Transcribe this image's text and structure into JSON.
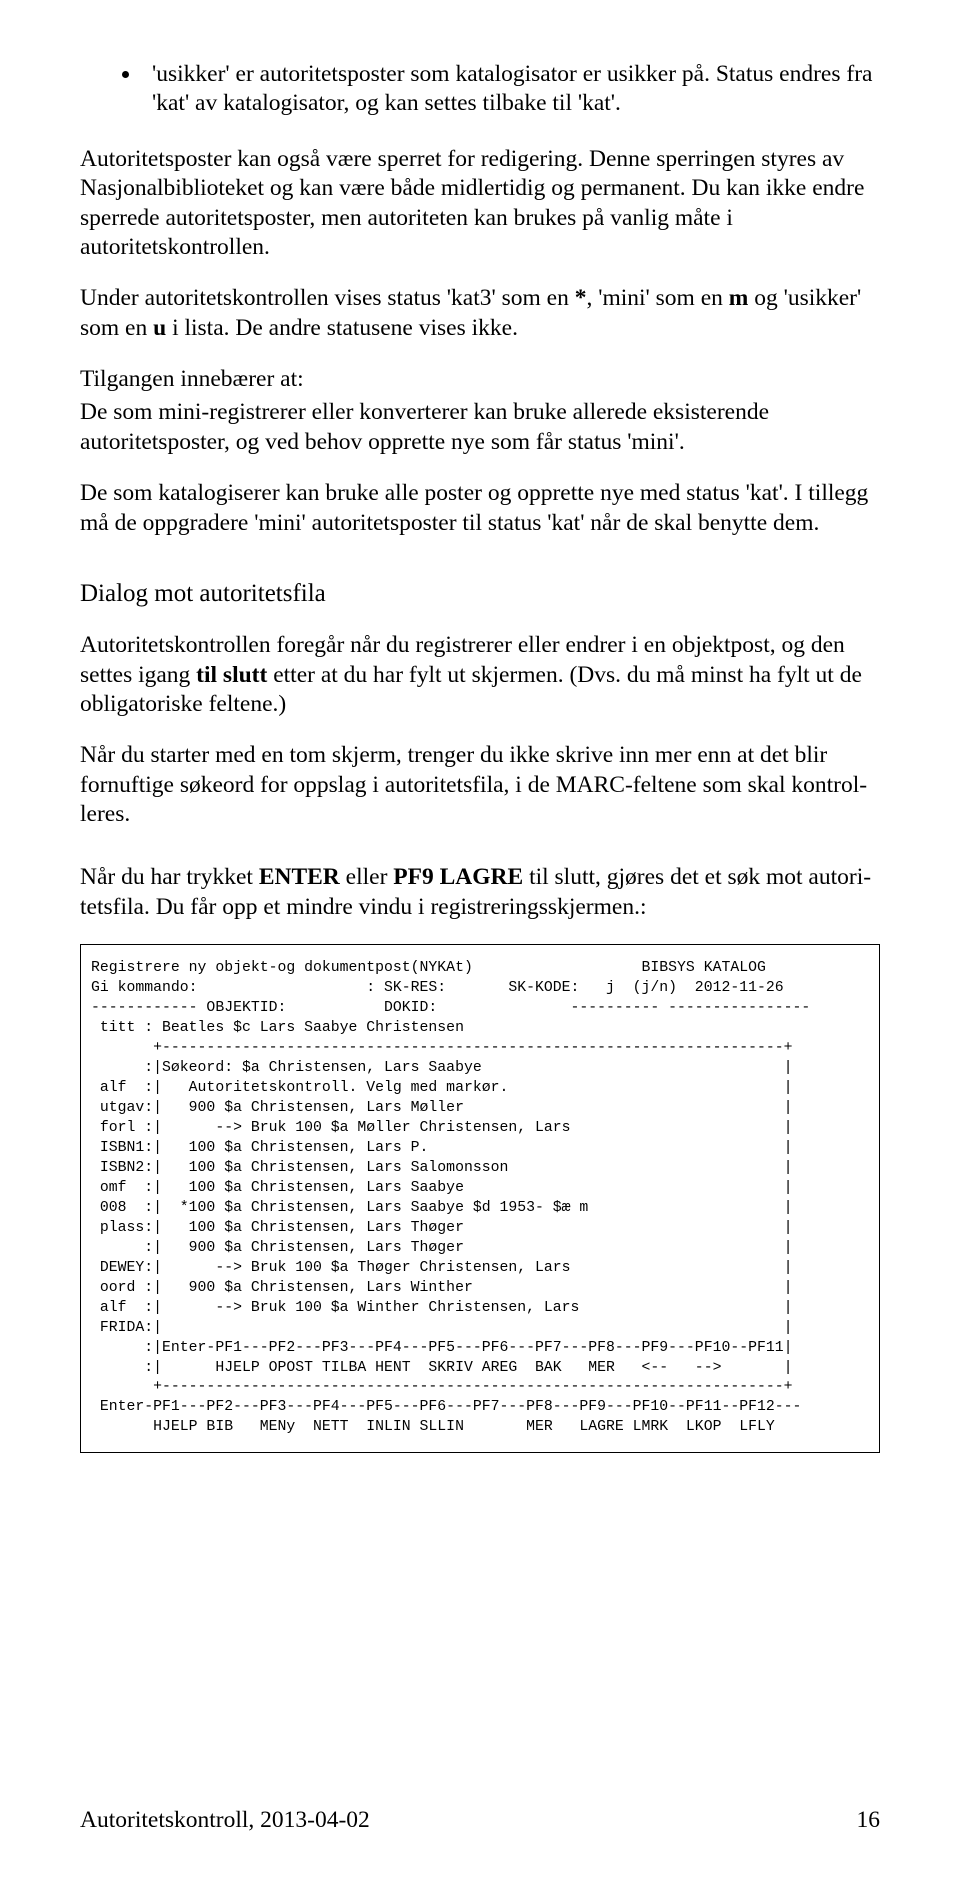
{
  "bullet": "'usikker' er autoritetsposter som katalogisator er usikker på. Status endres fra 'kat' av katalogisator, og kan settes tilbake til 'kat'.",
  "p1": "Autoritetsposter kan også være sperret for redigering. Denne sperringen styres av Nasjonalbiblioteket og kan være både midlertidig og permanent. Du kan ikke endre sperrede autoritetsposter, men autoriteten kan brukes på vanlig måte i autoritetskontrollen.",
  "p2_a": "Under autoritetskontrollen vises status 'kat3' som en ",
  "p2_b": ", 'mini' som en ",
  "p2_c": " og 'usikker' som en ",
  "p2_d": " i lista. De andre statusene vises ikke.",
  "star": "*",
  "m": "m",
  "u": "u",
  "p3": "Tilgangen innebærer at:",
  "p4": "De som mini-registrerer eller konverterer kan bruke allerede eksisterende autoritetsposter, og ved behov opprette nye som får status 'mini'.",
  "p5": "De som katalogiserer kan bruke alle poster og opprette nye med status 'kat'. I tillegg må de oppgradere 'mini' autoritetsposter til status 'kat' når de skal benytte dem.",
  "heading": "Dialog mot autoritetsfila",
  "p6_a": "Autoritetskontrollen foregår når du registrerer eller endrer i en objektpost, og den settes igang ",
  "p6_bold": "til slutt",
  "p6_b": " etter at du har fylt ut skjermen. (Dvs. du må minst ha fylt ut de obligatoriske feltene.)",
  "p7": "Når du starter med en tom skjerm, trenger du ikke skrive inn mer enn at det blir fornuftige søkeord for oppslag i autoritetsfila, i de MARC-feltene som skal kontrol­leres.",
  "p8_a": "Når du har trykket ",
  "p8_b1": "ENTER",
  "p8_c": " eller ",
  "p8_b2": "PF9 LAGRE",
  "p8_d": " til slutt, gjøres det et søk mot autori­tetsfila. Du får opp et mindre vindu i registreringsskjermen.:",
  "screen": "Registrere ny objekt-og dokumentpost(NYKAt)                   BIBSYS KATALOG\nGi kommando:                   : SK-RES:       SK-KODE:   j  (j/n)  2012-11-26\n------------ OBJEKTID:           DOKID:               ---------- ----------------\n titt : Beatles $c Lars Saabye Christensen\n       +----------------------------------------------------------------------+\n      :|Søkeord: $a Christensen, Lars Saabye                                  |\n alf  :|   Autoritetskontroll. Velg med markør.                               |\n utgav:|   900 $a Christensen, Lars Møller                                    |\n forl :|      --> Bruk 100 $a Møller Christensen, Lars                        |\n ISBN1:|   100 $a Christensen, Lars P.                                        |\n ISBN2:|   100 $a Christensen, Lars Salomonsson                               |\n omf  :|   100 $a Christensen, Lars Saabye                                    |\n 008  :|  *100 $a Christensen, Lars Saabye $d 1953- $æ m                      |\n plass:|   100 $a Christensen, Lars Thøger                                    |\n      :|   900 $a Christensen, Lars Thøger                                    |\n DEWEY:|      --> Bruk 100 $a Thøger Christensen, Lars                        |\n oord :|   900 $a Christensen, Lars Winther                                   |\n alf  :|      --> Bruk 100 $a Winther Christensen, Lars                       |\n FRIDA:|                                                                      |\n      :|Enter-PF1---PF2---PF3---PF4---PF5---PF6---PF7---PF8---PF9---PF10--PF11|\n      :|      HJELP OPOST TILBA HENT  SKRIV AREG  BAK   MER   <--   -->       |\n       +----------------------------------------------------------------------+\n Enter-PF1---PF2---PF3---PF4---PF5---PF6---PF7---PF8---PF9---PF10--PF11--PF12---\n       HJELP BIB   MENy  NETT  INLIN SLLIN       MER   LAGRE LMRK  LKOP  LFLY",
  "footer_left": "Autoritetskontroll, 2013-04-02",
  "footer_right": "16"
}
